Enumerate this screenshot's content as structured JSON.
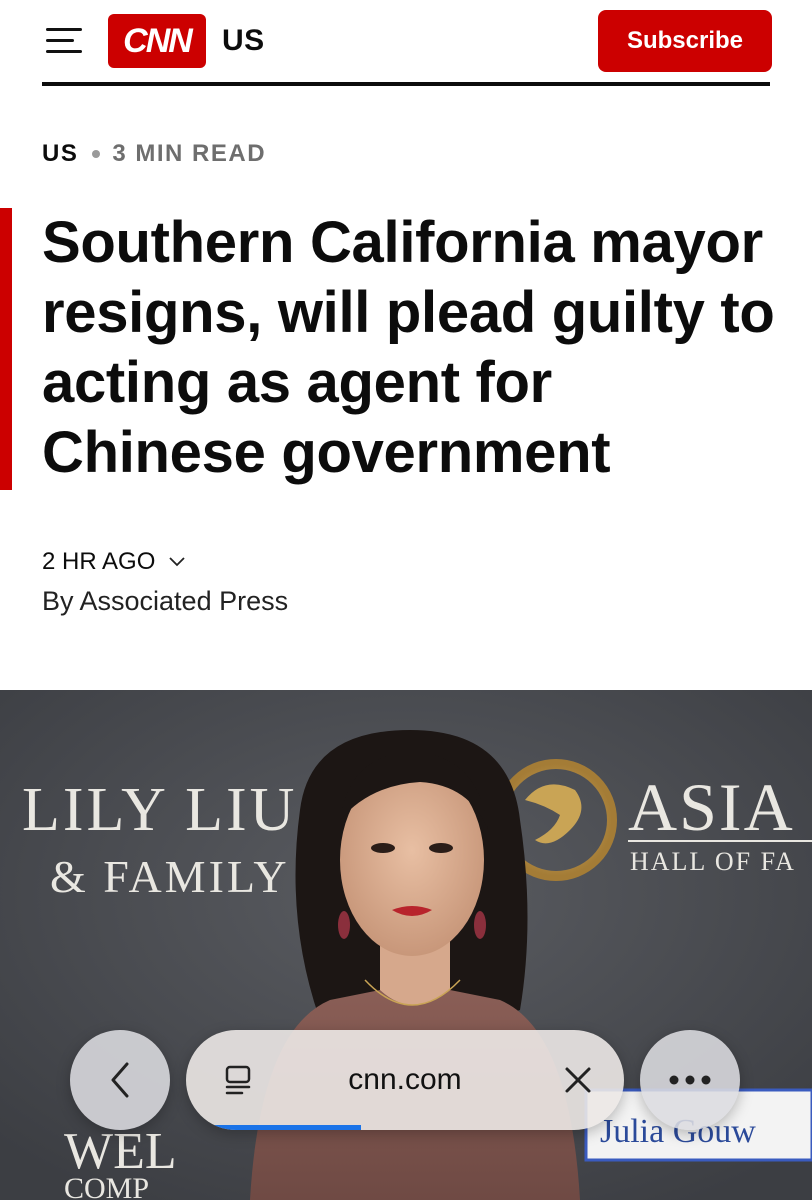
{
  "header": {
    "menu_icon": "hamburger-menu-icon",
    "logo_text": "CNN",
    "edition": "US",
    "subscribe_label": "Subscribe",
    "brand_color": "#cc0000"
  },
  "article": {
    "section": "US",
    "read_time": "3 MIN READ",
    "headline": "Southern California mayor resigns, will plead guilty to acting as agent for Chinese government",
    "timestamp": "2 HR AGO",
    "byline": "By Associated Press"
  },
  "hero_image": {
    "backdrop_text": {
      "line1": "LILY LIU",
      "line2": "& FAMILY",
      "right1": "ASIA",
      "right2": "HALL OF FA",
      "bottom_left1": "WEL",
      "bottom_left2": "COMP",
      "nameplate": "Julia Gouw"
    }
  },
  "browser_bar": {
    "back_icon": "chevron-left-icon",
    "reader_icon": "reader-mode-icon",
    "url": "cnn.com",
    "clear_icon": "close-icon",
    "more_icon": "more-dots-icon",
    "load_progress": 0.4
  }
}
